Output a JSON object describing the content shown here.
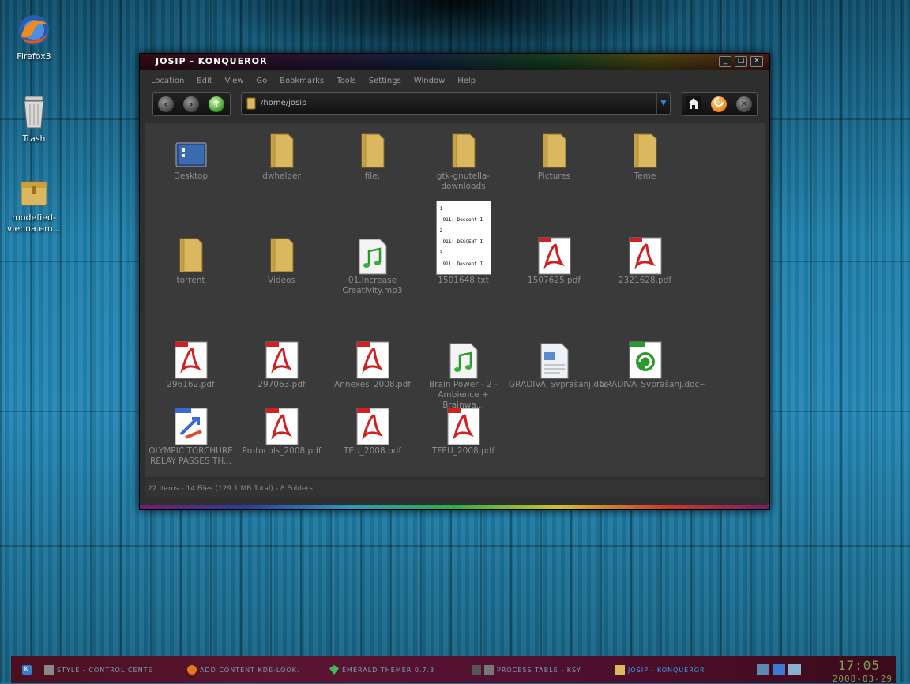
{
  "desktop": {
    "icons": [
      {
        "label": "Firefox3"
      },
      {
        "label": "Trash"
      },
      {
        "label": "modefied-vienna.em..."
      }
    ]
  },
  "window": {
    "title": "JOSIP - KONQUEROR",
    "menu": [
      "Location",
      "Edit",
      "View",
      "Go",
      "Bookmarks",
      "Tools",
      "Settings",
      "Window",
      "Help"
    ],
    "address": "/home/josip",
    "items": [
      {
        "name": "Desktop",
        "icon": "desktop-folder-icon"
      },
      {
        "name": "dwhelper",
        "icon": "folder-icon"
      },
      {
        "name": "file:",
        "icon": "folder-icon"
      },
      {
        "name": "gtk-gnutella-downloads",
        "icon": "folder-icon"
      },
      {
        "name": "Pictures",
        "icon": "pictures-folder-icon"
      },
      {
        "name": "Teme",
        "icon": "folder-icon"
      },
      {
        "name": "torrent",
        "icon": "web-folder-icon"
      },
      {
        "name": "Videos",
        "icon": "video-folder-icon"
      },
      {
        "name": "01.Increase Creativity.mp3",
        "icon": "audio-file-icon"
      },
      {
        "name": "1501648.txt",
        "icon": "text-preview-icon"
      },
      {
        "name": "1507625.pdf",
        "icon": "pdf-icon"
      },
      {
        "name": "2321628.pdf",
        "icon": "pdf-icon"
      },
      {
        "name": "296162.pdf",
        "icon": "pdf-icon"
      },
      {
        "name": "297063.pdf",
        "icon": "pdf-icon"
      },
      {
        "name": "Annexes_2008.pdf",
        "icon": "pdf-icon"
      },
      {
        "name": "Brain Power - 2 - Ambience + Brainwa...",
        "icon": "audio-file-icon"
      },
      {
        "name": "GRADIVA_Svprašanj.doc",
        "icon": "doc-file-icon"
      },
      {
        "name": "GRADIVA_Svprašanj.doc~",
        "icon": "backup-file-icon"
      },
      {
        "name": "OLYMPIC TORCHURE RELAY PASSES TH...",
        "icon": "shortcut-file-icon"
      },
      {
        "name": "Protocols_2008.pdf",
        "icon": "pdf-icon"
      },
      {
        "name": "TEU_2008.pdf",
        "icon": "pdf-icon"
      },
      {
        "name": "TFEU_2008.pdf",
        "icon": "pdf-icon"
      }
    ],
    "txt_preview": [
      "1",
      "911: Descent I",
      "2",
      "911: DESCENT I",
      "3",
      "911: Descent I"
    ],
    "status": "22 Items - 14 Files (129.1 MB Total) - 8 Folders"
  },
  "taskbar": {
    "tasks": [
      {
        "label": "STYLE - CONTROL CENTE"
      },
      {
        "label": "ADD CONTENT KDE-LOOK."
      },
      {
        "label": "EMERALD THEMER 0.7.3"
      },
      {
        "label": "PROCESS TABLE - KSY"
      },
      {
        "label": "JOSIP - KONQUEROR"
      }
    ],
    "clock": "17:05",
    "date": "2008-03-29"
  }
}
